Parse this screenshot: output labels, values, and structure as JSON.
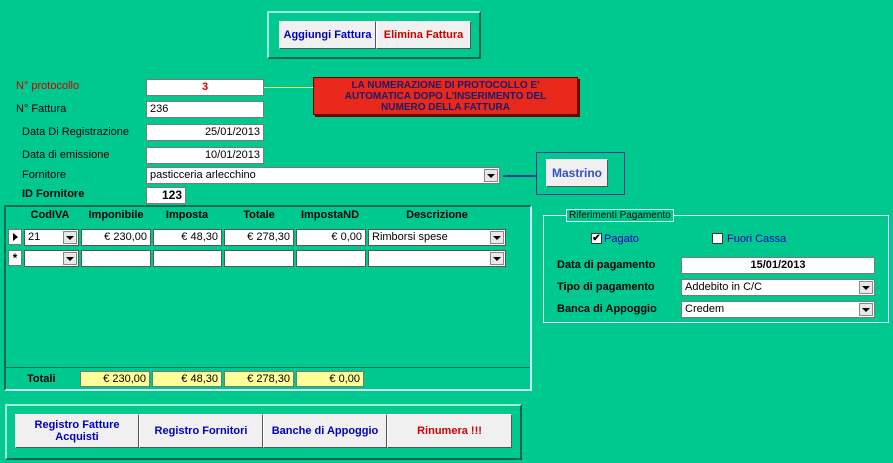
{
  "toolbar": {
    "add_invoice": "Aggiungi Fattura",
    "delete_invoice": "Elimina Fattura"
  },
  "form": {
    "protocol_label": "N° protocollo",
    "protocol_value": "3",
    "invoice_no_label": "N° Fattura",
    "invoice_no_value": "236",
    "reg_date_label": "Data Di Registrazione",
    "reg_date_value": "25/01/2013",
    "issue_date_label": "Data di emissione",
    "issue_date_value": "10/01/2013",
    "supplier_label": "Fornitore",
    "supplier_value": "pasticceria arlecchino",
    "supplier_id_label": "ID Fornitore",
    "supplier_id_value": "123",
    "notice_line1": "LA NUMERAZIONE DI PROTOCOLLO E'",
    "notice_line2": "AUTOMATICA DOPO L'INSERIMENTO DEL",
    "notice_line3": "NUMERO DELLA FATTURA",
    "ledger_button": "Mastrino"
  },
  "table": {
    "headers": [
      "CodIVA",
      "Imponibile",
      "Imposta",
      "Totale",
      "ImpostaND",
      "Descrizione"
    ],
    "rows": [
      {
        "codiva": "21",
        "imponibile": "€ 230,00",
        "imposta": "€ 48,30",
        "totale": "€ 278,30",
        "impostand": "€ 0,00",
        "descrizione": "Rimborsi spese"
      }
    ],
    "new_row_marker": "*",
    "totals_label": "Totali",
    "totals": {
      "imponibile": "€ 230,00",
      "imposta": "€ 48,30",
      "totale": "€ 278,30",
      "impostand": "€ 0,00"
    }
  },
  "payment": {
    "group_title": "Riferimenti Pagamento",
    "paid_label": "Pagato",
    "paid_checked": true,
    "off_cash_label": "Fuori Cassa",
    "off_cash_checked": false,
    "date_label": "Data di pagamento",
    "date_value": "15/01/2013",
    "type_label": "Tipo di pagamento",
    "type_value": "Addebito in C/C",
    "bank_label": "Banca di Appoggio",
    "bank_value": "Credem"
  },
  "footer": {
    "registry_invoices": "Registro Fatture Acquisti",
    "registry_suppliers": "Registro Fornitori",
    "banks": "Banche di Appoggio",
    "renumber": "Rinumera !!!"
  },
  "colors": {
    "background": "#00c98f",
    "notice": "#e8281a",
    "link_blue": "#0000c0",
    "danger_red": "#d00000"
  }
}
